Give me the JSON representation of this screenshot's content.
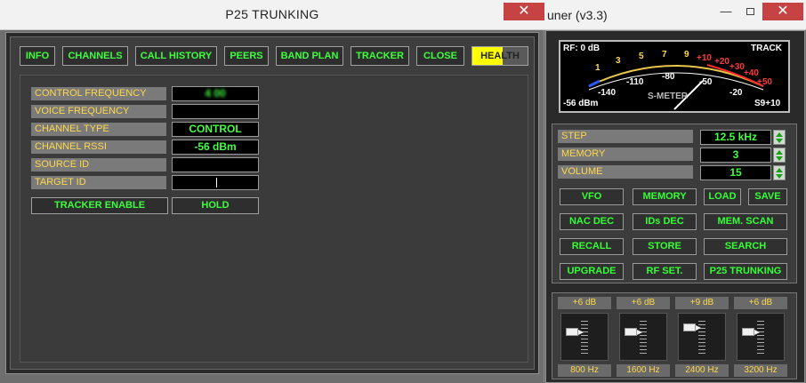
{
  "p25": {
    "title": "P25 TRUNKING",
    "close_glyph": "✕",
    "nav": [
      "INFO",
      "CHANNELS",
      "CALL HISTORY",
      "PEERS",
      "BAND PLAN",
      "TRACKER",
      "CLOSE",
      "HEALTH"
    ],
    "fields": [
      {
        "label": "CONTROL FREQUENCY",
        "value": "4          00"
      },
      {
        "label": "VOICE FREQUENCY",
        "value": ""
      },
      {
        "label": "CHANNEL TYPE",
        "value": "CONTROL"
      },
      {
        "label": "CHANNEL RSSI",
        "value": "-56 dBm"
      },
      {
        "label": "SOURCE ID",
        "value": ""
      },
      {
        "label": "TARGET ID",
        "value": ""
      }
    ],
    "tracker_enable": "TRACKER ENABLE",
    "hold": "HOLD"
  },
  "tuner": {
    "title": "uner (v3.3)",
    "min_glyph": "—",
    "close_glyph": "✕",
    "meter": {
      "rf": "RF: 0 dB",
      "track": "TRACK",
      "label": "S-METER",
      "dbm": "-56 dBm",
      "s_reading": "S9+10",
      "scale_top": [
        "1",
        "3",
        "5",
        "7",
        "9",
        "+10",
        "+20",
        "+30",
        "+40",
        "+50"
      ],
      "scale_bottom": [
        "-140",
        "-110",
        "-80",
        "-50",
        "-20"
      ]
    },
    "settings": [
      {
        "label": "STEP",
        "value": "12.5 kHz"
      },
      {
        "label": "MEMORY",
        "value": "3"
      },
      {
        "label": "VOLUME",
        "value": "15"
      }
    ],
    "buttons": {
      "vfo": "VFO",
      "memory": "MEMORY",
      "load": "LOAD",
      "save": "SAVE",
      "nac_dec": "NAC DEC",
      "ids_dec": "IDs DEC",
      "mem_scan": "MEM. SCAN",
      "recall": "RECALL",
      "store": "STORE",
      "search": "SEARCH",
      "upgrade": "UPGRADE",
      "rf_set": "RF SET.",
      "p25_trunking": "P25 TRUNKING"
    },
    "eq": [
      {
        "gain": "+6 dB",
        "freq": "800 Hz"
      },
      {
        "gain": "+6 dB",
        "freq": "1600 Hz"
      },
      {
        "gain": "+9 dB",
        "freq": "2400 Hz"
      },
      {
        "gain": "+6 dB",
        "freq": "3200 Hz"
      }
    ]
  }
}
